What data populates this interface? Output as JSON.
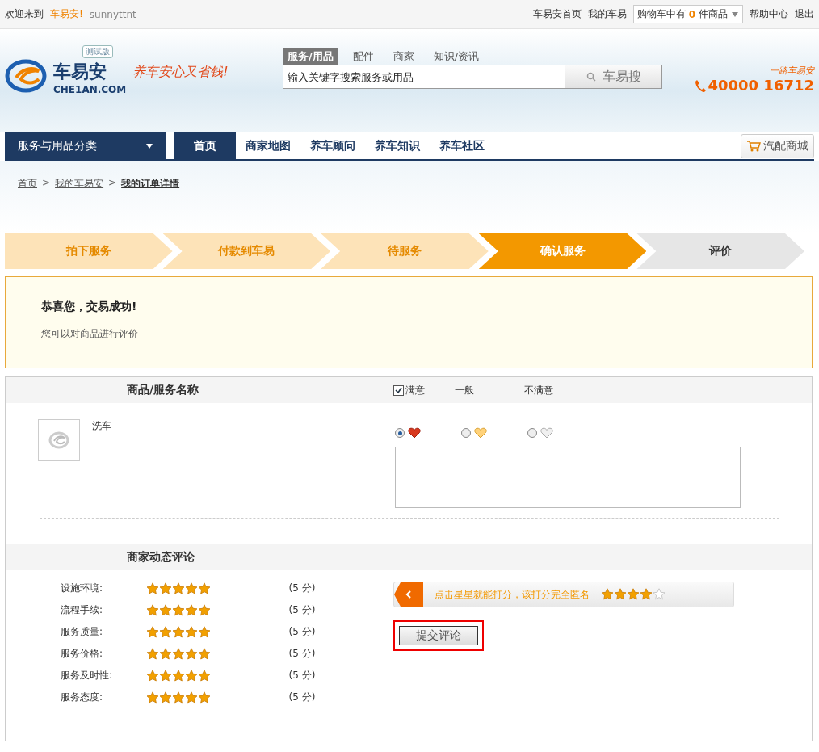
{
  "top_bar": {
    "welcome": "欢迎来到",
    "site_name": "车易安!",
    "username": "sunnyttnt",
    "links": [
      "车易安首页",
      "我的车易"
    ],
    "cart": {
      "prefix": "购物车中有",
      "count": "0",
      "suffix": "件商品"
    },
    "links_right": [
      "帮助中心",
      "退出"
    ]
  },
  "header": {
    "logo_text": "车易安",
    "logo_domain": "CHE1AN.COM",
    "beta_badge": "测试版",
    "slogan": "养车安心又省钱!",
    "search_tabs": [
      {
        "label": "服务/用品",
        "selected": true
      },
      {
        "label": "配件",
        "selected": false
      },
      {
        "label": "商家",
        "selected": false
      },
      {
        "label": "知识/资讯",
        "selected": false
      }
    ],
    "search": {
      "placeholder": "输入关键字搜索服务或用品",
      "button": "车易搜"
    },
    "hotline_caption": "一路车易安",
    "hotline": "40000 16712"
  },
  "nav": {
    "category": "服务与用品分类",
    "items": [
      {
        "label": "首页",
        "selected": true
      },
      {
        "label": "商家地图",
        "selected": false
      },
      {
        "label": "养车顾问",
        "selected": false
      },
      {
        "label": "养车知识",
        "selected": false
      },
      {
        "label": "养车社区",
        "selected": false
      }
    ],
    "mall": "汽配商城"
  },
  "breadcrumb": {
    "items": [
      "首页",
      "我的车易安",
      "我的订单详情"
    ],
    "separator": ">"
  },
  "steps": [
    {
      "label": "拍下服务",
      "kind": "done"
    },
    {
      "label": "付款到车易",
      "kind": "done"
    },
    {
      "label": "待服务",
      "kind": "done"
    },
    {
      "label": "确认服务",
      "kind": "current"
    },
    {
      "label": "评价",
      "kind": "pending"
    }
  ],
  "notice": {
    "title": "恭喜您，交易成功!",
    "text": "您可以对商品进行评价"
  },
  "review": {
    "column_title": "商品/服务名称",
    "satisfied_checkbox": {
      "label": "满意",
      "checked": true
    },
    "headers": [
      "一般",
      "不满意"
    ],
    "product": "洗车",
    "options": [
      {
        "kind": "good",
        "selected": true
      },
      {
        "kind": "neutral",
        "selected": false
      },
      {
        "kind": "bad",
        "selected": false
      }
    ]
  },
  "merchant": {
    "title": "商家动态评论",
    "ratings": [
      {
        "label": "设施环境:",
        "stars": 5,
        "score": "(5 分)"
      },
      {
        "label": "流程手续:",
        "stars": 5,
        "score": "(5 分)"
      },
      {
        "label": "服务质量:",
        "stars": 5,
        "score": "(5 分)"
      },
      {
        "label": "服务价格:",
        "stars": 5,
        "score": "(5 分)"
      },
      {
        "label": "服务及时性:",
        "stars": 5,
        "score": "(5 分)"
      },
      {
        "label": "服务态度:",
        "stars": 5,
        "score": "(5 分)"
      }
    ],
    "tip": {
      "text": "点击星星就能打分，该打分完全匿名",
      "stars": 4
    },
    "submit": "提交评论"
  }
}
